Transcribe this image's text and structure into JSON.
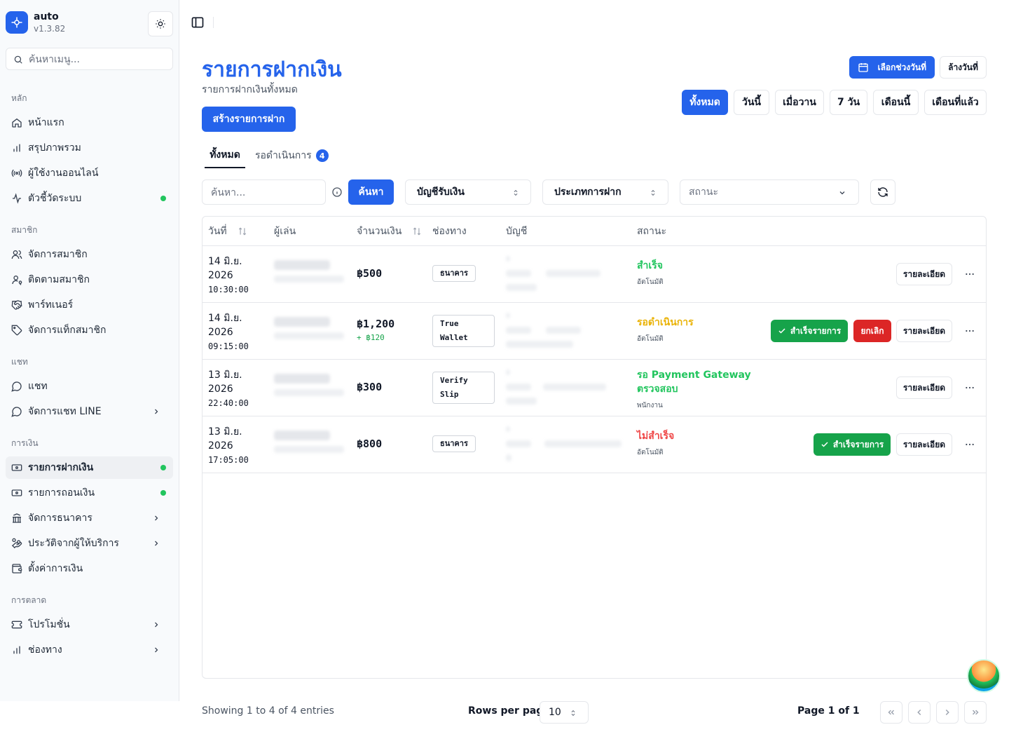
{
  "app": {
    "name": "auto",
    "version": "v1.3.82"
  },
  "sidebar": {
    "search_placeholder": "ค้นหาเมนู...",
    "groups": {
      "main": "หลัก",
      "member": "สมาชิก",
      "chat": "แชท",
      "finance": "การเงิน",
      "marketing": "การตลาด"
    },
    "items": {
      "home": "หน้าแรก",
      "overview": "สรุปภาพรวม",
      "online": "ผู้ใช้งานออนไลน์",
      "metrics": "ตัวชี้วัดระบบ",
      "manage_members": "จัดการสมาชิก",
      "track_members": "ติดตามสมาชิก",
      "partner": "พาร์ทเนอร์",
      "member_tags": "จัดการแท็กสมาชิก",
      "chat": "แชท",
      "line_chat": "จัดการแชท LINE",
      "deposits": "รายการฝากเงิน",
      "withdrawals": "รายการถอนเงิน",
      "banks": "จัดการธนาคาร",
      "provider_history": "ประวัติจากผู้ให้บริการ",
      "finance_settings": "ตั้งค่าการเงิน",
      "promotions": "โปรโมชั่น",
      "channels": "ช่องทาง"
    }
  },
  "page": {
    "title": "รายการฝากเงิน",
    "subtitle": "รายการฝากเงินทั้งหมด",
    "create_button": "สร้างรายการฝาก",
    "date_range_button": "เลือกช่วงวันที่",
    "clear_date_button": "ล้างวันที่",
    "ranges": [
      "ทั้งหมด",
      "วันนี้",
      "เมื่อวาน",
      "7 วัน",
      "เดือนนี้",
      "เดือนที่แล้ว"
    ],
    "tabs": {
      "all": "ทั้งหมด",
      "pending": "รอดำเนินการ",
      "pending_count": "4"
    }
  },
  "filters": {
    "search_placeholder": "ค้นหา...",
    "search_button": "ค้นหา",
    "account_select": "บัญชีรับเงิน",
    "type_select": "ประเภทการฝาก",
    "status_placeholder": "สถานะ"
  },
  "table": {
    "headers": {
      "date": "วันที่",
      "player": "ผู้เล่น",
      "amount": "จำนวนเงิน",
      "channel": "ช่องทาง",
      "account": "บัญชี",
      "status": "สถานะ"
    },
    "rows": [
      {
        "date": "14 มิ.ย.",
        "year": "2026",
        "time": "10:30:00",
        "amount": "฿500",
        "bonus": "",
        "channel": "ธนาคาร",
        "status": "สำเร็จ",
        "status_sub": "อัตโนมัติ"
      },
      {
        "date": "14 มิ.ย.",
        "year": "2026",
        "time": "09:15:00",
        "amount": "฿1,200",
        "bonus": "+ ฿120",
        "channel_l1": "True",
        "channel_l2": "Wallet",
        "status": "รอดำเนินการ",
        "status_sub": "อัตโนมัติ"
      },
      {
        "date": "13 มิ.ย.",
        "year": "2026",
        "time": "22:40:00",
        "amount": "฿300",
        "bonus": "",
        "channel_l1": "Verify",
        "channel_l2": "Slip",
        "status": "รอ Payment Gateway ตรวจสอบ",
        "status_sub": "พนักงาน"
      },
      {
        "date": "13 มิ.ย.",
        "year": "2026",
        "time": "17:05:00",
        "amount": "฿800",
        "bonus": "",
        "channel": "ธนาคาร",
        "status": "ไม่สำเร็จ",
        "status_sub": "อัตโนมัติ"
      }
    ],
    "actions": {
      "detail": "รายละเอียด",
      "approve": "สำเร็จรายการ",
      "cancel": "ยกเลิก"
    }
  },
  "footer": {
    "showing": "Showing 1 to 4 of 4 entries",
    "rows_per_page_label": "Rows per page",
    "rows_per_page_value": "10",
    "page_info": "Page 1 of 1"
  },
  "colors": {
    "primary": "#2563eb",
    "success": "#22c55e",
    "warning": "#eab308",
    "danger": "#ef4444"
  }
}
